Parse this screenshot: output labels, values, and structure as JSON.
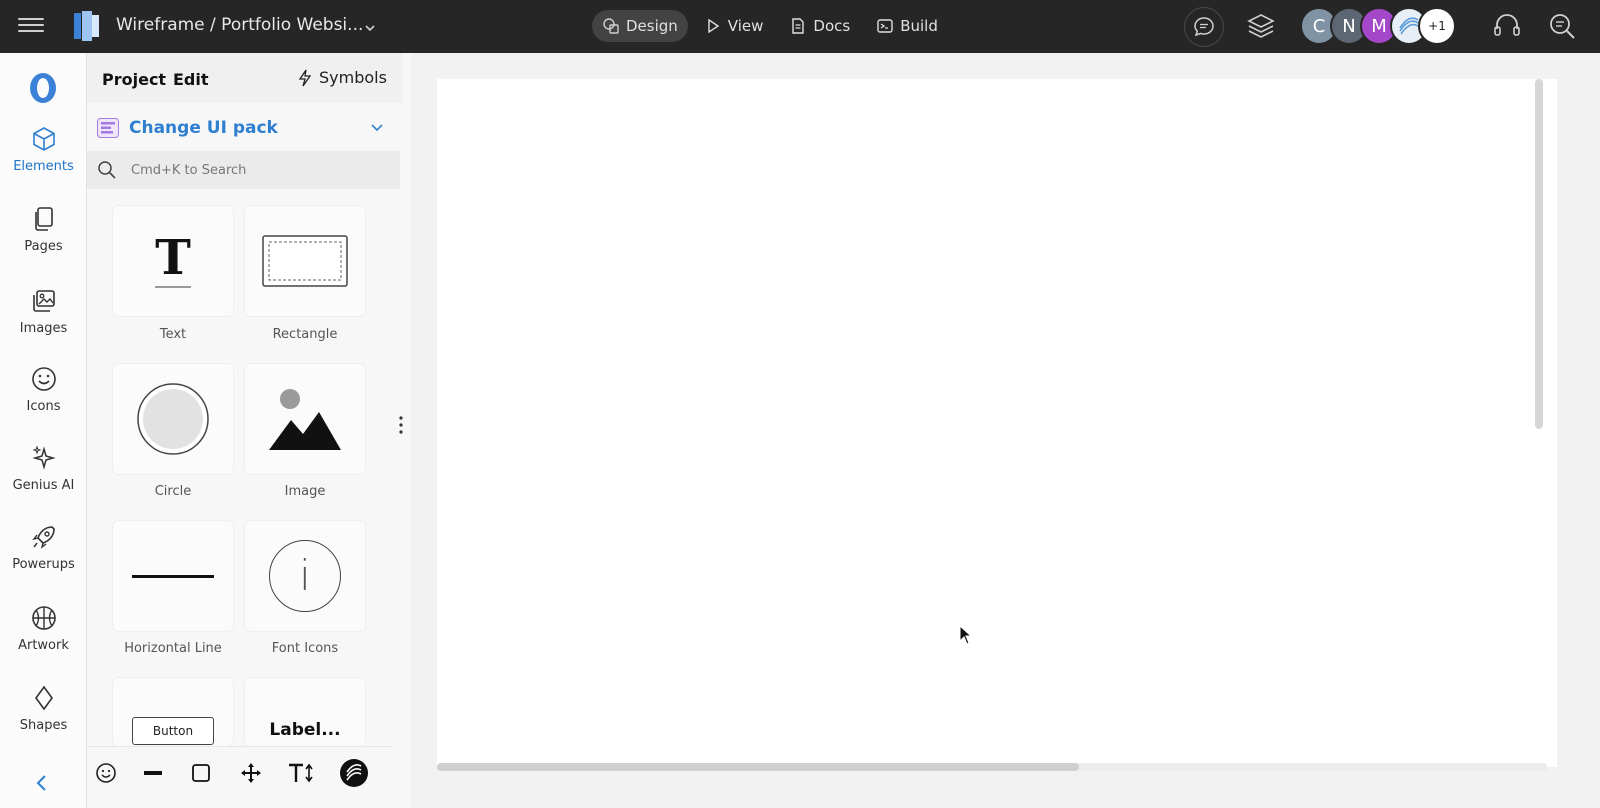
{
  "topbar": {
    "project_title": "Wireframe / Portfolio Websi...",
    "nav": [
      {
        "label": "Design",
        "active": true
      },
      {
        "label": "View",
        "active": false
      },
      {
        "label": "Docs",
        "active": false
      },
      {
        "label": "Build",
        "active": false
      }
    ],
    "avatars": [
      {
        "initial": "C",
        "color": "#7f93a4"
      },
      {
        "initial": "N",
        "color": "#5c6773"
      },
      {
        "initial": "M",
        "color": "#a447c9"
      },
      {
        "initial": "",
        "color": "#e8eef5"
      },
      {
        "initial": "+1",
        "color": "#ffffff"
      }
    ]
  },
  "rail": {
    "items": [
      {
        "label": "Elements",
        "icon": "cube-icon",
        "active": true
      },
      {
        "label": "Pages",
        "icon": "pages-icon",
        "active": false
      },
      {
        "label": "Images",
        "icon": "images-icon",
        "active": false
      },
      {
        "label": "Icons",
        "icon": "smiley-icon",
        "active": false
      },
      {
        "label": "Genius AI",
        "icon": "sparkle-icon",
        "active": false
      },
      {
        "label": "Powerups",
        "icon": "rocket-icon",
        "active": false
      },
      {
        "label": "Artwork",
        "icon": "basketball-icon",
        "active": false
      },
      {
        "label": "Shapes",
        "icon": "diamond-icon",
        "active": false
      }
    ]
  },
  "panel": {
    "tabs": {
      "project": "Project",
      "edit": "Edit",
      "symbols": "Symbols"
    },
    "ui_pack_label": "Change UI pack",
    "search_placeholder": "Cmd+K to Search",
    "tiles": {
      "text": {
        "label": "Text",
        "glyph": "T"
      },
      "rectangle": {
        "label": "Rectangle"
      },
      "circle": {
        "label": "Circle"
      },
      "image": {
        "label": "Image"
      },
      "horizontal_line": {
        "label": "Horizontal Line"
      },
      "font_icons": {
        "label": "Font Icons",
        "glyph": "i"
      },
      "button": {
        "preview_text": "Button"
      },
      "label": {
        "preview_text": "Label..."
      }
    }
  },
  "colors": {
    "accent": "#2f7fd1",
    "topbar_bg": "#262626"
  }
}
